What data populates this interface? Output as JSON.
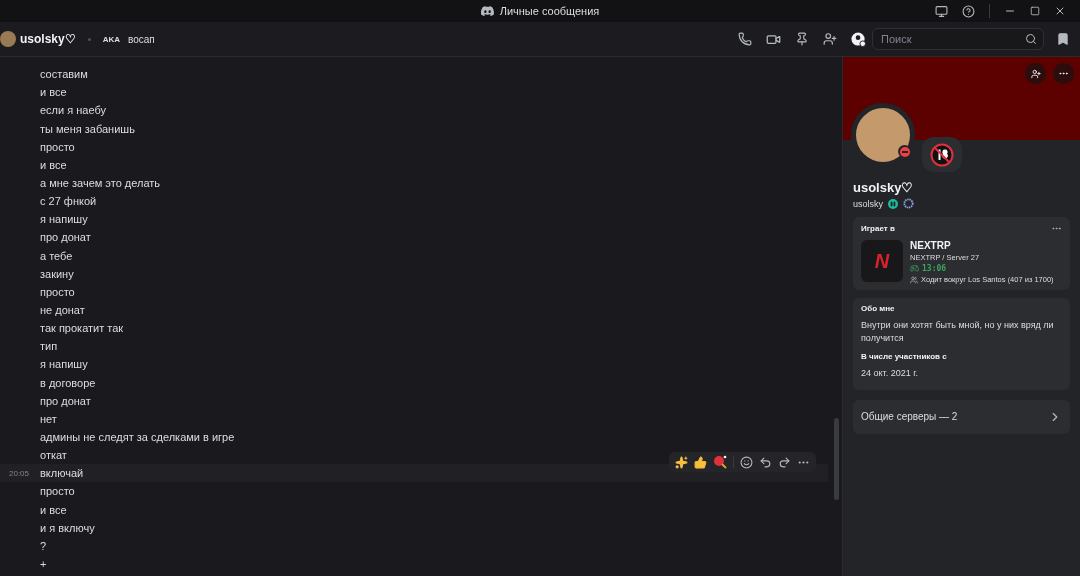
{
  "window": {
    "title": "Личные сообщения"
  },
  "header": {
    "name": "usolsky♡",
    "aka_label": "AKA",
    "nickname": "восап",
    "search": {
      "placeholder": "Поиск"
    }
  },
  "messages": [
    {
      "text": "составим",
      "hovered": false
    },
    {
      "text": "и все",
      "hovered": false
    },
    {
      "text": "если я наебу",
      "hovered": false
    },
    {
      "text": "ты меня забанишь",
      "hovered": false
    },
    {
      "text": "просто",
      "hovered": false
    },
    {
      "text": "и все",
      "hovered": false
    },
    {
      "text": "а мне зачем это делать",
      "hovered": false
    },
    {
      "text": "с 27 фнкой",
      "hovered": false
    },
    {
      "text": "я напишу",
      "hovered": false
    },
    {
      "text": "про донат",
      "hovered": false
    },
    {
      "text": "а тебе",
      "hovered": false
    },
    {
      "text": "закину",
      "hovered": false
    },
    {
      "text": "просто",
      "hovered": false
    },
    {
      "text": "не донат",
      "hovered": false
    },
    {
      "text": "так прокатит так",
      "hovered": false
    },
    {
      "text": "тип",
      "hovered": false
    },
    {
      "text": "я напишу",
      "hovered": false
    },
    {
      "text": "в договоре",
      "hovered": false
    },
    {
      "text": "про донат",
      "hovered": false
    },
    {
      "text": "нет",
      "hovered": false
    },
    {
      "text": "админы не следят за сделками в игре",
      "hovered": false
    },
    {
      "text": "откат",
      "hovered": false
    },
    {
      "text": "включай",
      "time": "20:05",
      "hovered": true
    },
    {
      "text": "просто",
      "hovered": false
    },
    {
      "text": "и все",
      "hovered": false
    },
    {
      "text": "и я включу",
      "hovered": false
    },
    {
      "text": "?",
      "hovered": false
    },
    {
      "text": "+",
      "hovered": false
    }
  ],
  "profile": {
    "display_name": "usolsky♡",
    "username": "usolsky",
    "activity": {
      "heading": "Играет в",
      "logo": "N",
      "game": "NEXTRP",
      "detail": "NEXTRP / Server 27",
      "elapsed": "13:06",
      "state": "Ходит вокруг Los Santos (407 из 1700)"
    },
    "about": {
      "heading": "Обо мне",
      "text": "Внутри они хотят быть мной, но у них вряд ли получится",
      "member_heading": "В числе участников с",
      "member_since": "24 окт. 2021 г."
    },
    "mutual_servers": "Общие серверы — 2"
  }
}
